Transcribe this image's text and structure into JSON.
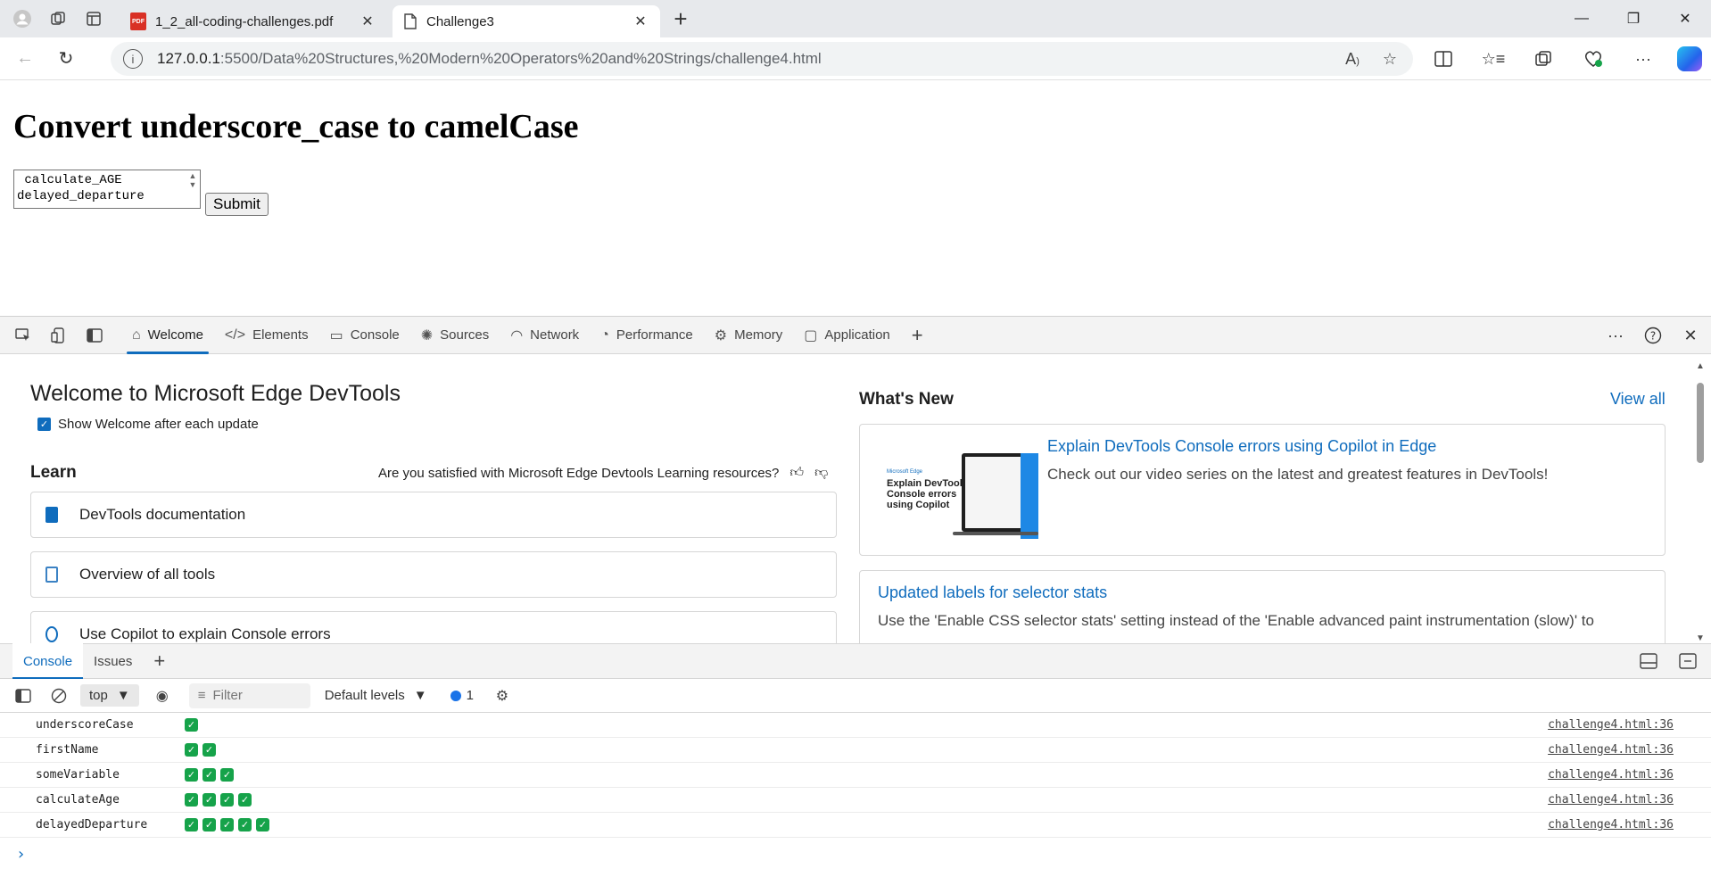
{
  "browser": {
    "tabs": [
      {
        "title": "1_2_all-coding-challenges.pdf",
        "badge": "PDF",
        "active": false
      },
      {
        "title": "Challenge3",
        "active": true
      }
    ],
    "url_host": "127.0.0.1",
    "url_path": ":5500/Data%20Structures,%20Modern%20Operators%20and%20Strings/challenge4.html"
  },
  "page": {
    "heading": "Convert underscore_case to camelCase",
    "textarea_value": " calculate_AGE\ndelayed_departure",
    "submit_label": "Submit"
  },
  "devtools": {
    "tabs": [
      {
        "label": "Welcome",
        "icon": "home-icon",
        "active": true
      },
      {
        "label": "Elements",
        "icon": "code-icon"
      },
      {
        "label": "Console",
        "icon": "console-icon"
      },
      {
        "label": "Sources",
        "icon": "bug-icon"
      },
      {
        "label": "Network",
        "icon": "wifi-icon"
      },
      {
        "label": "Performance",
        "icon": "gauge-icon"
      },
      {
        "label": "Memory",
        "icon": "chip-icon"
      },
      {
        "label": "Application",
        "icon": "window-icon"
      }
    ],
    "welcome": {
      "title": "Welcome to Microsoft Edge DevTools",
      "show_after_update": "Show Welcome after each update",
      "learn_heading": "Learn",
      "survey": "Are you satisfied with Microsoft Edge Devtools Learning resources?",
      "cards": [
        {
          "label": "DevTools documentation",
          "color": "#0f6cbd"
        },
        {
          "label": "Overview of all tools",
          "color": "#3b82c4"
        },
        {
          "label": "Use Copilot to explain Console errors",
          "color": "#0f6cbd"
        }
      ],
      "whats_new_heading": "What's New",
      "view_all": "View all",
      "news": [
        {
          "title": "Explain DevTools Console errors using Copilot in Edge",
          "desc": "Check out our video series on the latest and greatest features in DevTools!",
          "thumb_brand": "Microsoft Edge",
          "thumb_caption": "Explain DevTools Console errors using Copilot"
        },
        {
          "title": "Updated labels for selector stats",
          "desc": "Use the 'Enable CSS selector stats' setting instead of the 'Enable advanced paint instrumentation (slow)' to"
        }
      ]
    },
    "drawer_tabs": [
      "Console",
      "Issues"
    ],
    "console_toolbar": {
      "context": "top",
      "filter_placeholder": "Filter",
      "levels": "Default levels",
      "issues_count": "1"
    },
    "log_rows": [
      {
        "var": "underscoreCase",
        "checks": 1,
        "source": "challenge4.html:36"
      },
      {
        "var": "firstName",
        "checks": 2,
        "source": "challenge4.html:36"
      },
      {
        "var": "someVariable",
        "checks": 3,
        "source": "challenge4.html:36"
      },
      {
        "var": "calculateAge",
        "checks": 4,
        "source": "challenge4.html:36"
      },
      {
        "var": "delayedDeparture",
        "checks": 5,
        "source": "challenge4.html:36"
      }
    ]
  },
  "colors": {
    "accent": "#0f6cbd",
    "check_green": "#16a34a"
  }
}
